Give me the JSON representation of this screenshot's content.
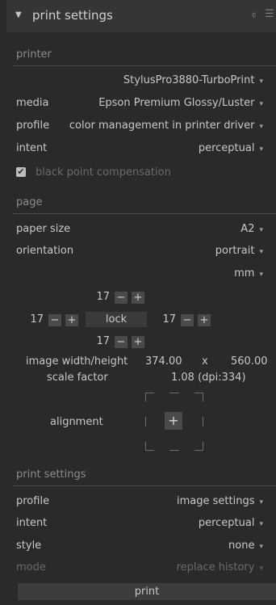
{
  "header": {
    "title": "print settings",
    "reset_glyph": "⌽",
    "presets_glyph": "☰"
  },
  "printer": {
    "section_label": "printer",
    "printer_name": "StylusPro3880-TurboPrint",
    "media_label": "media",
    "media_value": "Epson Premium Glossy/Luster",
    "profile_label": "profile",
    "profile_value": "color management in printer driver",
    "intent_label": "intent",
    "intent_value": "perceptual",
    "bpc_label": "black point compensation",
    "bpc_checked": true
  },
  "page": {
    "section_label": "page",
    "paper_size_label": "paper size",
    "paper_size_value": "A2",
    "orientation_label": "orientation",
    "orientation_value": "portrait",
    "unit_value": "mm",
    "margin_top": "17",
    "margin_left": "17",
    "margin_right": "17",
    "margin_bottom": "17",
    "lock_label": "lock",
    "image_wh_label": "image width/height",
    "image_width": "374.00",
    "image_x": "x",
    "image_height": "560.00",
    "scale_label": "scale factor",
    "scale_value": "1.08 (dpi:334)",
    "alignment_label": "alignment"
  },
  "print_settings": {
    "section_label": "print settings",
    "profile_label": "profile",
    "profile_value": "image settings",
    "intent_label": "intent",
    "intent_value": "perceptual",
    "style_label": "style",
    "style_value": "none",
    "mode_label": "mode",
    "mode_value": "replace history",
    "print_button": "print"
  },
  "glyphs": {
    "dropdown_arrow": "▾",
    "minus": "−",
    "plus": "+",
    "collapse_triangle": "▼",
    "checkmark": "✔",
    "center_plus": "+"
  }
}
